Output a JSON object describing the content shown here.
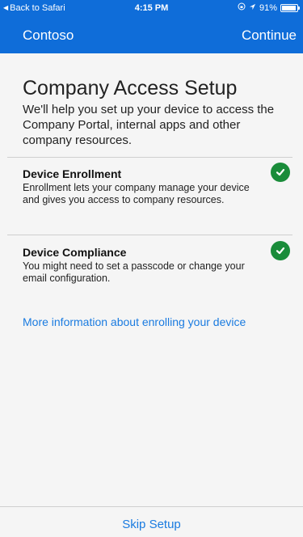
{
  "status_bar": {
    "back_label": "Back to Safari",
    "time": "4:15 PM",
    "battery": "91%"
  },
  "nav": {
    "title": "Contoso",
    "continue_label": "Continue"
  },
  "main": {
    "title": "Company Access Setup",
    "description": "We'll help you set up your device to access the Company Portal, internal apps and other company resources.",
    "sections": [
      {
        "title": "Device Enrollment",
        "description": "Enrollment lets your company manage your device and gives you access to company resources.",
        "status_icon": "checkmark-circle-icon"
      },
      {
        "title": "Device Compliance",
        "description": "You might need to set a passcode or change your email configuration.",
        "status_icon": "checkmark-circle-icon"
      }
    ],
    "more_link": "More information about enrolling your device"
  },
  "footer": {
    "skip_label": "Skip Setup"
  },
  "colors": {
    "brand": "#0f6dd9",
    "link": "#1a7be0",
    "success": "#1a8c3a"
  }
}
